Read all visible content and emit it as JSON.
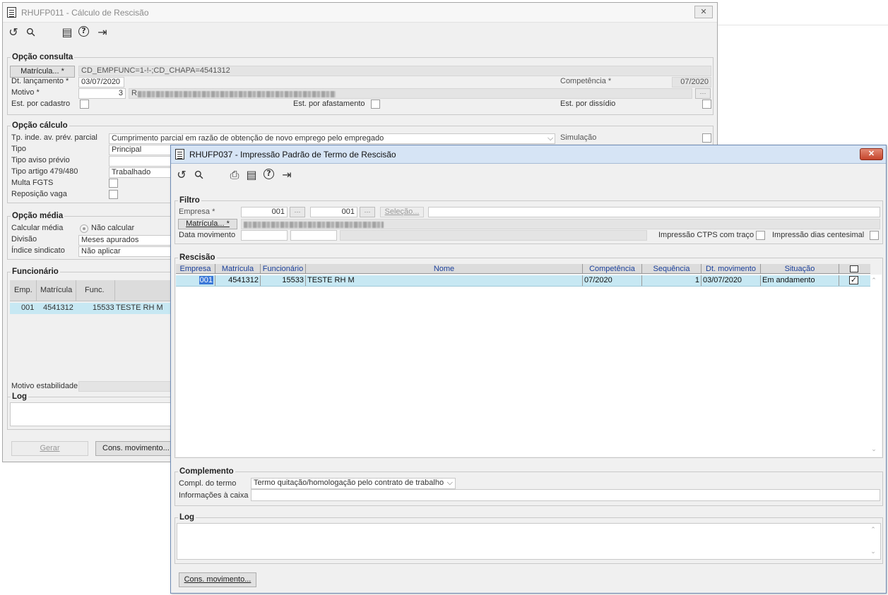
{
  "back_window": {
    "title": "RHUFP011 - Cálculo de Rescisão",
    "opcao_consulta": {
      "legend": "Opção consulta",
      "matricula_button": "Matrícula... *",
      "matricula_value": "CD_EMPFUNC=1-!-;CD_CHAPA=4541312",
      "dt_lancamento_label": "Dt. lançamento *",
      "dt_lancamento_value": "03/07/2020",
      "competencia_label": "Competência *",
      "competencia_value": "07/2020",
      "motivo_label": "Motivo *",
      "motivo_code": "3",
      "motivo_desc_first": "R",
      "est_cadastro_label": "Est. por cadastro",
      "est_afastamento_label": "Est. por afastamento",
      "est_dissidio_label": "Est. por dissídio"
    },
    "opcao_calculo": {
      "legend": "Opção cálculo",
      "tp_inde_label": "Tp. inde. av. prév. parcial",
      "tp_inde_value": "Cumprimento parcial em razão de obtenção de novo emprego pelo empregado",
      "simulacao_label": "Simulação",
      "tipo_label": "Tipo",
      "tipo_value": "Principal",
      "tipo_aviso_label": "Tipo aviso prévio",
      "tipo_artigo_label": "Tipo artigo 479/480",
      "tipo_artigo_value": "Trabalhado",
      "multa_fgts_label": "Multa FGTS",
      "reposicao_label": "Reposição vaga"
    },
    "opcao_media": {
      "legend": "Opção média",
      "calcular_label": "Calcular média",
      "calcular_value": "Não calcular",
      "divisao_label": "Divisão",
      "divisao_value": "Meses apurados",
      "indice_label": "Índice sindicato",
      "indice_value": "Não aplicar"
    },
    "funcionario": {
      "legend": "Funcionário",
      "headers": [
        "Emp.",
        "Matrícula",
        "Func."
      ],
      "row": {
        "emp": "001",
        "matricula": "4541312",
        "func": "15533",
        "nome": "TESTE RH M"
      },
      "motivo_estab_label": "Motivo estabilidade"
    },
    "log_legend": "Log",
    "gerar_button": "Gerar",
    "cons_mov_button": "Cons. movimento..."
  },
  "front_window": {
    "title": "RHUFP037 - Impressão Padrão de Termo de Rescisão",
    "filtro": {
      "legend": "Filtro",
      "empresa_label": "Empresa *",
      "empresa_from": "001",
      "empresa_to": "001",
      "selecao_button": "Seleção...",
      "matricula_button": "Matrícula... *",
      "data_mov_label": "Data movimento",
      "ctps_label": "Impressão CTPS com traço",
      "dias_label": "Impressão dias centesimal"
    },
    "rescisao": {
      "legend": "Rescisão",
      "headers": [
        "Empresa",
        "Matrícula",
        "Funcionário",
        "Nome",
        "Competência",
        "Sequência",
        "Dt. movimento",
        "Situação"
      ],
      "rows": [
        {
          "empresa": "001",
          "matricula": "4541312",
          "funcionario": "15533",
          "nome": "TESTE RH M",
          "competencia": "07/2020",
          "sequencia": "1",
          "dt_movimento": "03/07/2020",
          "situacao": "Em andamento",
          "checked": true
        }
      ]
    },
    "complemento": {
      "legend": "Complemento",
      "compl_label": "Compl. do termo",
      "compl_value": "Termo quitação/homologação pelo contrato de trabalho",
      "info_label": "Informações à caixa"
    },
    "log_legend": "Log",
    "cons_mov_button": "Cons. movimento..."
  },
  "icons": {
    "undo": "↺",
    "search": "⚲",
    "calendar": "▤",
    "help": "?",
    "exit": "⇥",
    "print": "⎙",
    "check": "✓",
    "close": "✕"
  },
  "colors": {
    "selected_row": "#c7e8f3",
    "header_text": "#1a3f9a",
    "titlebar_active": "#d6e4f5",
    "close_red": "#c6452c"
  }
}
